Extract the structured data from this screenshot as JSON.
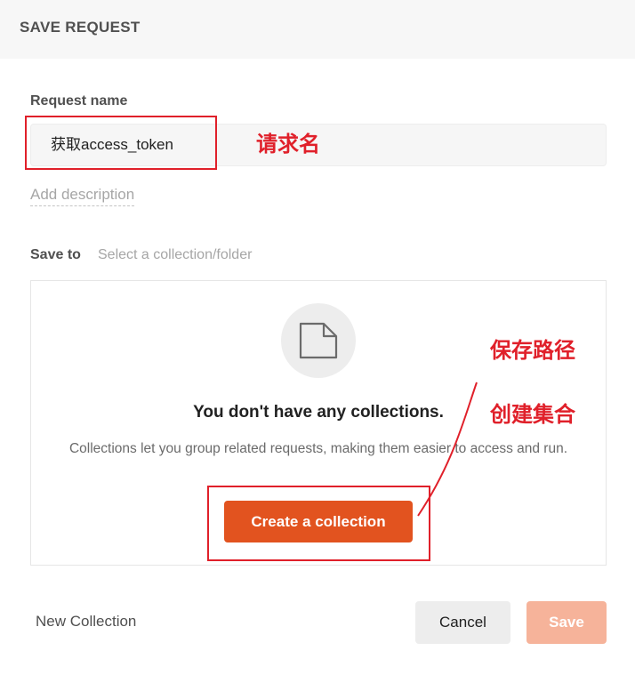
{
  "header": {
    "title": "SAVE REQUEST"
  },
  "request_name": {
    "label": "Request name",
    "value": "获取access_token"
  },
  "add_description": "Add description",
  "save_to": {
    "label": "Save to",
    "hint": "Select a collection/folder"
  },
  "empty_state": {
    "title": "You don't have any collections.",
    "description": "Collections let you group related requests, making them easier to access and run.",
    "create_label": "Create a collection",
    "icon": "folder-icon"
  },
  "footer": {
    "new_collection": "New Collection",
    "cancel": "Cancel",
    "save": "Save"
  },
  "annotations": {
    "request_name_note": "请求名",
    "save_path_note": "保存路径",
    "create_collection_note": "创建集合"
  },
  "colors": {
    "accent": "#e2531f",
    "accent_disabled": "#f6b39a",
    "annotation": "#e0202a"
  }
}
